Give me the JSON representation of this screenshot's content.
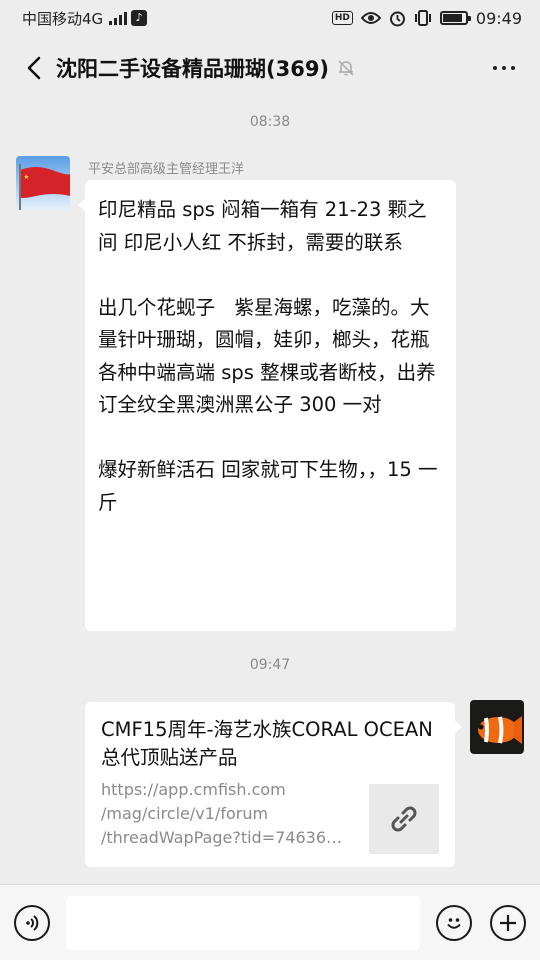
{
  "status_bar": {
    "carrier": "中国移动4G",
    "network_badge": "4G",
    "hd_label": "HD",
    "time": "09:49",
    "battery_level": 0.8
  },
  "nav": {
    "title": "沈阳二手设备精品珊瑚(369)",
    "back_icon": "chevron-left-icon",
    "mute_icon": "bell-muted-icon",
    "more_icon": "more-dots-icon"
  },
  "chat": {
    "timestamp_1": "08:38",
    "msg1": {
      "sender": "平安总部高级主管经理王洋",
      "text": "印尼精品 sps 闷箱一箱有 21-23 颗之间 印尼小人红 不拆封，需要的联系\n\n出几个花蚬子　紫星海螺，吃藻的。大量针叶珊瑚，圆帽，娃卯，榔头，花瓶\n各种中端高端 sps 整棵或者断枝，出养订全纹全黑澳洲黑公子 300 一对\n\n爆好新鲜活石 回家就可下生物，，15 一斤"
    },
    "timestamp_2": "09:47",
    "msg2": {
      "title": "CMF15周年-海艺水族CORAL OCEAN总代顶贴送产品",
      "url": "https://app.cmfish.com\n/mag/circle/v1/forum\n/threadWapPage?tid=74636…",
      "thumb_icon": "link-icon"
    }
  },
  "input_bar": {
    "voice_icon": "voice-icon",
    "emoji_icon": "emoji-icon",
    "plus_icon": "plus-icon",
    "input_value": ""
  }
}
